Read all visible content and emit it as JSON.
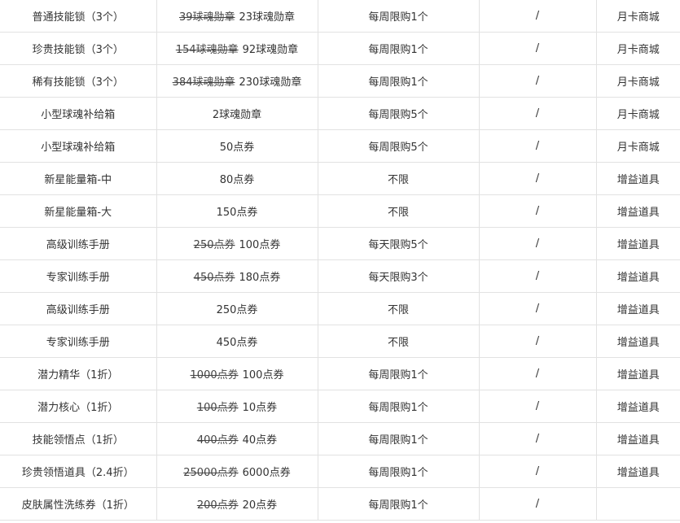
{
  "table": {
    "rows": [
      {
        "name": "普通技能锁（3个）",
        "old_price": "39球魂勋章",
        "price": "23球魂勋章",
        "limit": "每周限购1个",
        "extra": "/",
        "source": "月卡商城"
      },
      {
        "name": "珍贵技能锁（3个）",
        "old_price": "154球魂勋章",
        "price": "92球魂勋章",
        "limit": "每周限购1个",
        "extra": "/",
        "source": "月卡商城"
      },
      {
        "name": "稀有技能锁（3个）",
        "old_price": "384球魂勋章",
        "price": "230球魂勋章",
        "limit": "每周限购1个",
        "extra": "/",
        "source": "月卡商城"
      },
      {
        "name": "小型球魂补给箱",
        "old_price": "",
        "price": "2球魂勋章",
        "limit": "每周限购5个",
        "extra": "/",
        "source": "月卡商城"
      },
      {
        "name": "小型球魂补给箱",
        "old_price": "",
        "price": "50点券",
        "limit": "每周限购5个",
        "extra": "/",
        "source": "月卡商城"
      },
      {
        "name": "新星能量箱-中",
        "old_price": "",
        "price": "80点券",
        "limit": "不限",
        "extra": "/",
        "source": "增益道具"
      },
      {
        "name": "新星能量箱-大",
        "old_price": "",
        "price": "150点券",
        "limit": "不限",
        "extra": "/",
        "source": "增益道具"
      },
      {
        "name": "高级训练手册",
        "old_price": "250点券",
        "price": "100点券",
        "limit": "每天限购5个",
        "extra": "/",
        "source": "增益道具"
      },
      {
        "name": "专家训练手册",
        "old_price": "450点券",
        "price": "180点券",
        "limit": "每天限购3个",
        "extra": "/",
        "source": "增益道具"
      },
      {
        "name": "高级训练手册",
        "old_price": "",
        "price": "250点券",
        "limit": "不限",
        "extra": "/",
        "source": "增益道具"
      },
      {
        "name": "专家训练手册",
        "old_price": "",
        "price": "450点券",
        "limit": "不限",
        "extra": "/",
        "source": "增益道具"
      },
      {
        "name": "潜力精华（1折）",
        "old_price": "1000点券",
        "price": "100点券",
        "limit": "每周限购1个",
        "extra": "/",
        "source": "增益道具"
      },
      {
        "name": "潜力核心（1折）",
        "old_price": "100点券",
        "price": "10点券",
        "limit": "每周限购1个",
        "extra": "/",
        "source": "增益道具"
      },
      {
        "name": "技能领悟点（1折）",
        "old_price": "400点券",
        "price": "40点券",
        "limit": "每周限购1个",
        "extra": "/",
        "source": "增益道具"
      },
      {
        "name": "珍贵领悟道具（2.4折）",
        "old_price": "25000点券",
        "price": "6000点券",
        "limit": "每周限购1个",
        "extra": "/",
        "source": "增益道具"
      },
      {
        "name": "皮肤属性洗练券（1折）",
        "old_price": "200点券",
        "price": "20点券",
        "limit": "每周限购1个",
        "extra": "/",
        "source": ""
      }
    ]
  }
}
